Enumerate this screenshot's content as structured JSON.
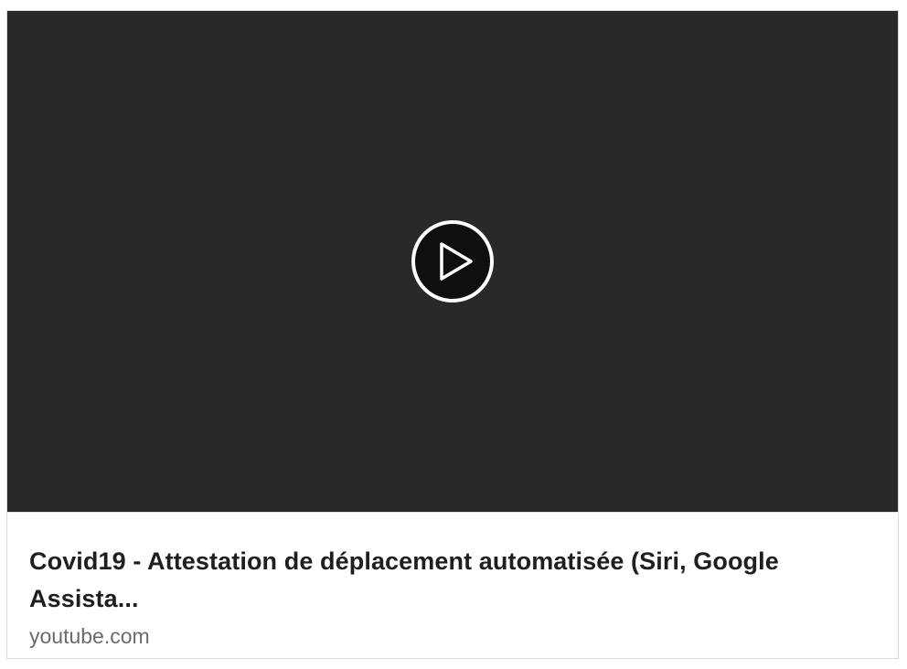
{
  "card": {
    "title": "Covid19 - Attestation de déplacement automatisée (Siri, Google Assista...",
    "source": "youtube.com"
  },
  "video": {
    "play_icon": "play-circle-icon"
  },
  "colors": {
    "video_background": "#28292b",
    "play_button_fill": "#0f0f10",
    "play_button_stroke": "#ffffff",
    "title_text": "#1f1f1f",
    "source_text": "#6b6b6b",
    "card_border": "#dcdcdc"
  }
}
